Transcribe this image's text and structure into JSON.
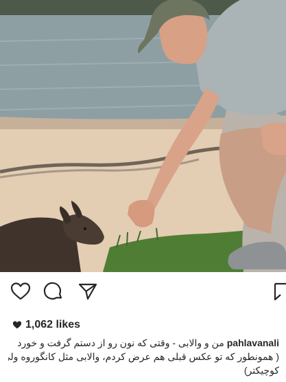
{
  "post": {
    "image": {
      "alt_subject": "man-feeding-wallaby-on-beach",
      "colors": {
        "water": "#8e9fa4",
        "sand": "#e3cdb3",
        "wallaby": "#3f332c",
        "shirt": "#aab3b5",
        "skin": "#d9a389",
        "grass": "#4f7d34"
      }
    },
    "actions": {
      "like_icon": "heart-outline-icon",
      "comment_icon": "comment-bubble-icon",
      "share_icon": "paper-plane-icon",
      "save_icon": "bookmark-icon"
    },
    "likes": {
      "icon": "heart-filled-icon",
      "count_text": "1,062 likes"
    },
    "caption": {
      "username": "pahlavanali",
      "line1": "من و والابی - وقتی که نون رو از دستم گرفت و خورد",
      "line2": "( همونطور که تو عکس قبلی هم عرض کردم، والابی مثل کانگوروه ولی",
      "line3": "کوچیکتر)"
    }
  }
}
